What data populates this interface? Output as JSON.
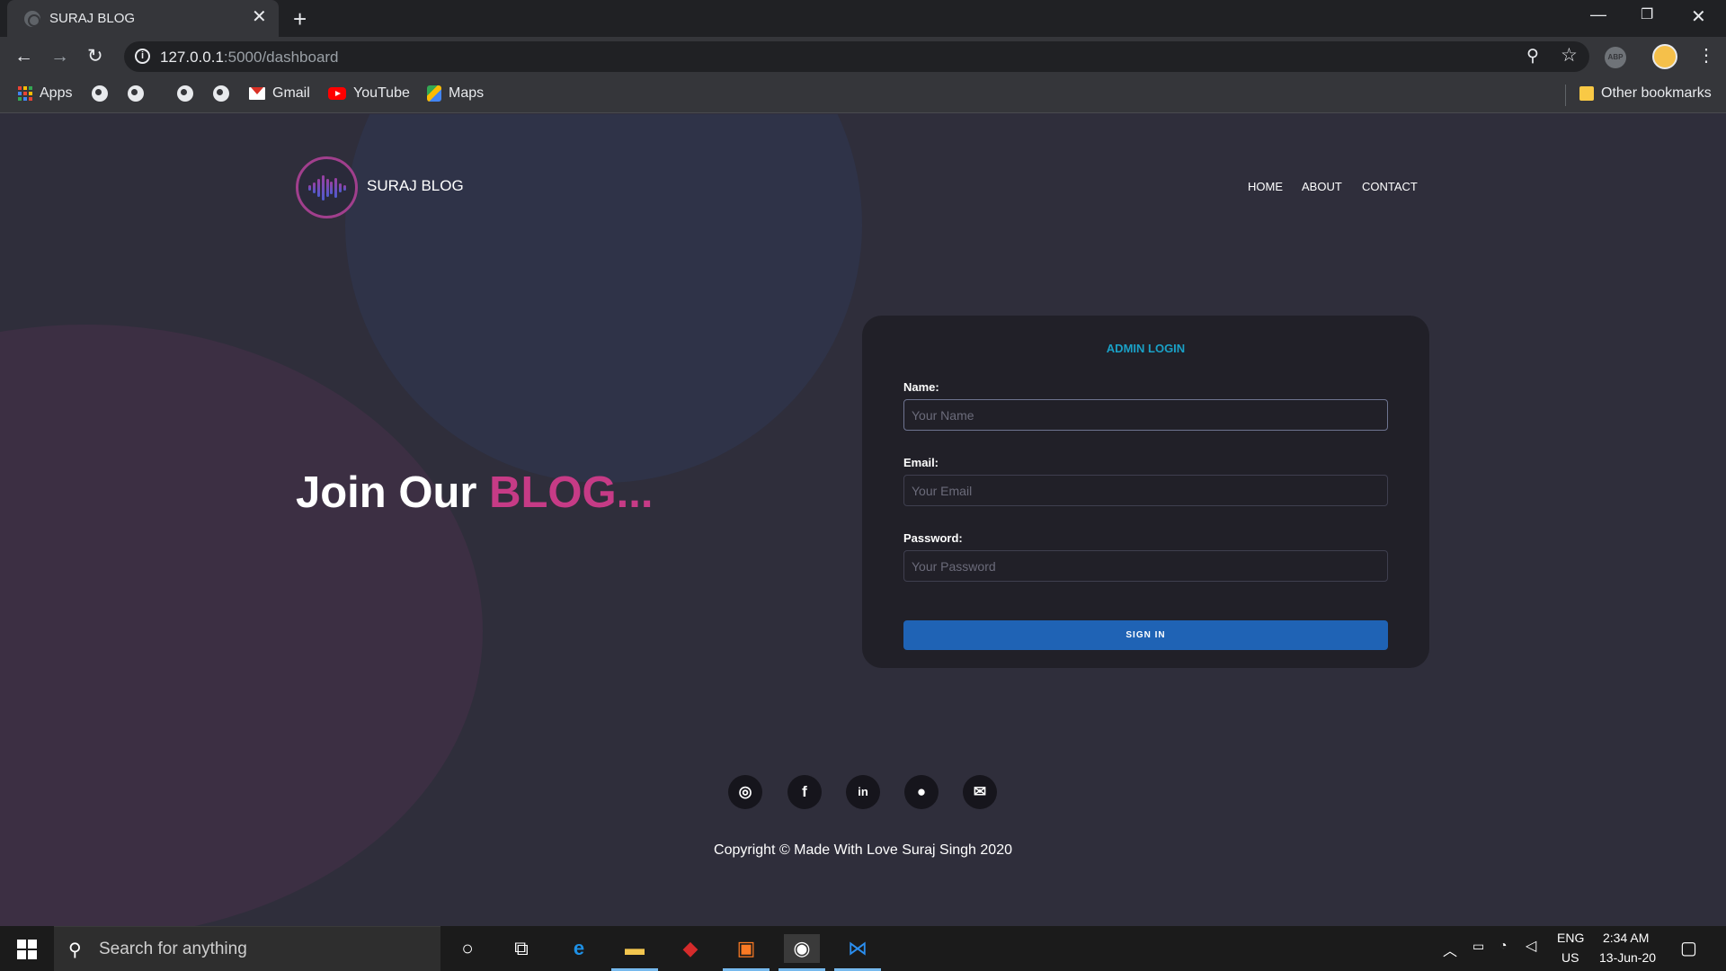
{
  "browser": {
    "tab_title": "SURAJ BLOG",
    "url_host": "127.0.0.1",
    "url_rest": ":5000/dashboard",
    "bookmarks": [
      {
        "label": "Apps",
        "icon": "apps-grid-icon"
      },
      {
        "label": "",
        "icon": "globe-icon"
      },
      {
        "label": "",
        "icon": "globe-icon"
      },
      {
        "label": "",
        "icon": "globe-icon"
      },
      {
        "label": "",
        "icon": "globe-icon"
      },
      {
        "label": "Gmail",
        "icon": "gmail-icon"
      },
      {
        "label": "YouTube",
        "icon": "youtube-icon"
      },
      {
        "label": "Maps",
        "icon": "maps-icon"
      }
    ],
    "other_bookmarks": "Other bookmarks"
  },
  "site": {
    "brand": "SURAJ BLOG",
    "nav": [
      "HOME",
      "ABOUT",
      "CONTACT"
    ],
    "hero_text": "Join Our",
    "hero_accent": "BLOG...",
    "colors": {
      "accent": "#c63b86",
      "button": "#1f63b5",
      "title": "#1aa0c6"
    }
  },
  "login": {
    "title": "ADMIN LOGIN",
    "name_label": "Name:",
    "name_placeholder": "Your Name",
    "email_label": "Email:",
    "email_placeholder": "Your Email",
    "password_label": "Password:",
    "password_placeholder": "Your Password",
    "submit": "SIGN IN"
  },
  "footer": {
    "social": [
      "instagram-icon",
      "facebook-icon",
      "linkedin-icon",
      "github-icon",
      "mail-icon"
    ],
    "copyright": "Copyright © Made With Love Suraj Singh 2020"
  },
  "taskbar": {
    "search_placeholder": "Search for anything",
    "lang_top": "ENG",
    "lang_bottom": "US",
    "time": "2:34 AM",
    "date": "13-Jun-20"
  }
}
